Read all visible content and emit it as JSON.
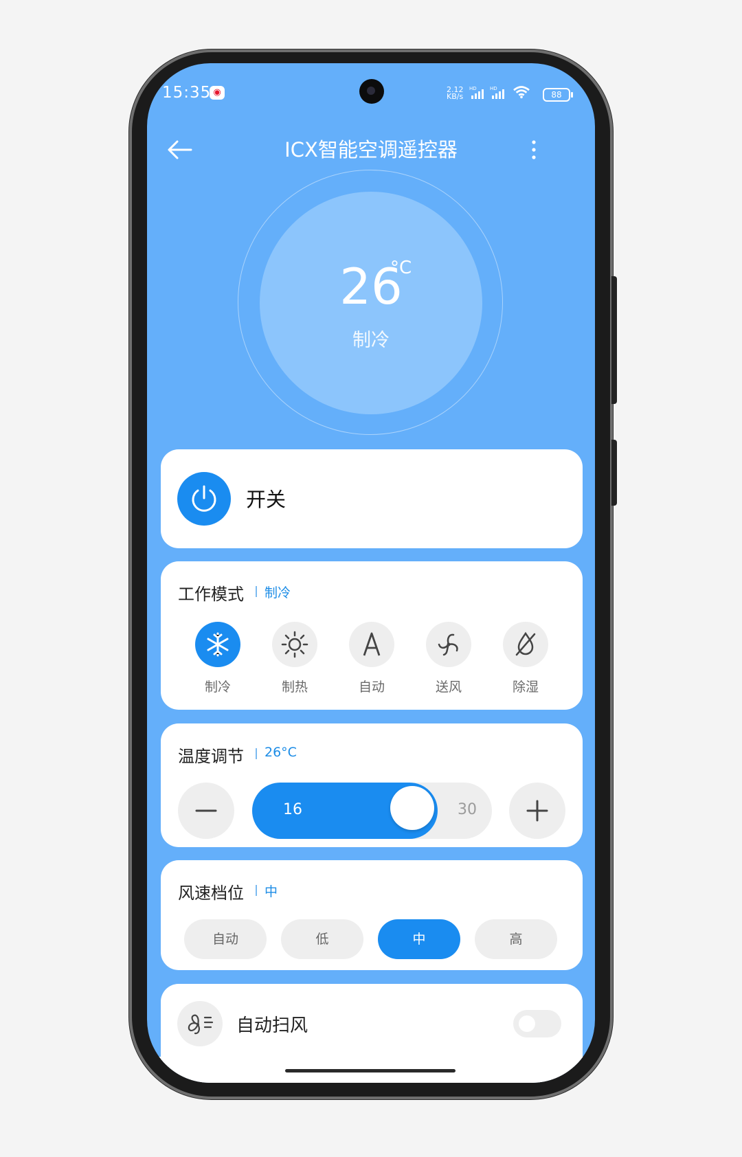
{
  "status_bar": {
    "time": "15:35",
    "app_notification_icon": "weibo-icon",
    "net_speed_value": "2.12",
    "net_speed_unit": "KB/s",
    "signal_tag": "HD",
    "battery": "88"
  },
  "header": {
    "title": "ICX智能空调遥控器",
    "back_icon": "back-arrow-icon",
    "more_icon": "more-vertical-icon"
  },
  "dial": {
    "temperature": "26",
    "unit": "°C",
    "mode": "制冷"
  },
  "power": {
    "label": "开关",
    "icon": "power-icon"
  },
  "work_mode": {
    "title": "工作模式",
    "current": "制冷",
    "modes": [
      {
        "label": "制冷",
        "icon": "snowflake-icon",
        "active": true
      },
      {
        "label": "制热",
        "icon": "sun-icon",
        "active": false
      },
      {
        "label": "自动",
        "icon": "auto-a-icon",
        "active": false
      },
      {
        "label": "送风",
        "icon": "fan-icon",
        "active": false
      },
      {
        "label": "除湿",
        "icon": "dehumidify-icon",
        "active": false
      }
    ]
  },
  "temperature_control": {
    "title": "温度调节",
    "current": "26°C",
    "min": "16",
    "max": "30",
    "value": 26,
    "minus_icon": "minus-icon",
    "plus_icon": "plus-icon"
  },
  "fan_speed": {
    "title": "风速档位",
    "current": "中",
    "options": [
      {
        "label": "自动",
        "active": false
      },
      {
        "label": "低",
        "active": false
      },
      {
        "label": "中",
        "active": true
      },
      {
        "label": "高",
        "active": false
      }
    ]
  },
  "swing": {
    "label": "自动扫风",
    "icon": "swing-fan-icon",
    "enabled": false
  },
  "colors": {
    "background_blue": "#64affa",
    "accent_blue": "#1a8cf0",
    "dial_blue": "#8cc5fc",
    "chip_gray": "#eeeeee"
  }
}
